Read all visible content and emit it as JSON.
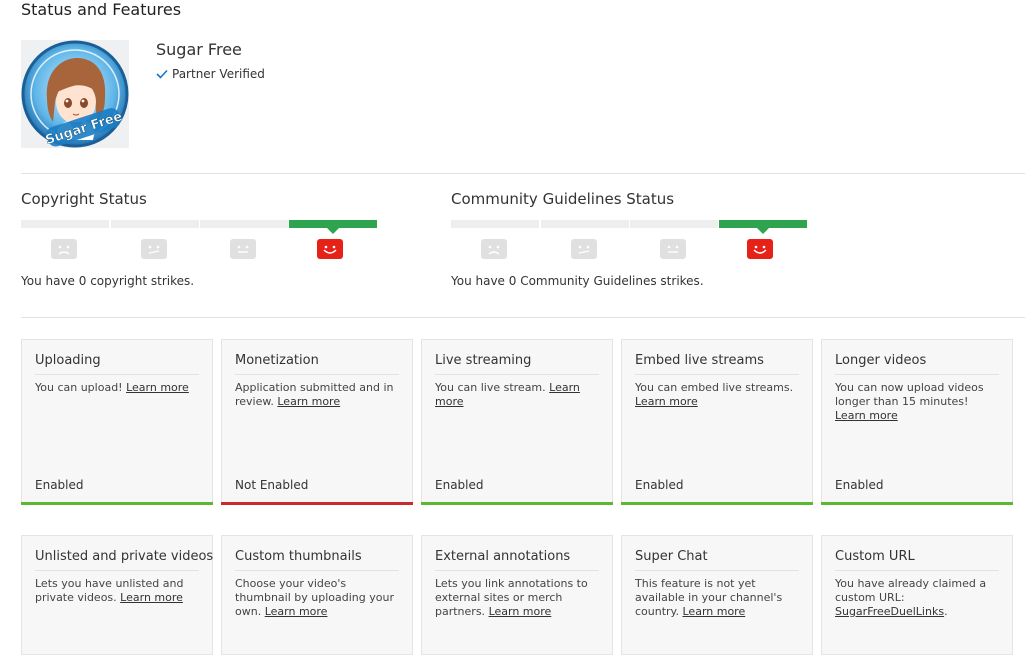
{
  "page": {
    "title": "Status and Features"
  },
  "channel": {
    "name": "Sugar Free",
    "verified_label": "Partner Verified",
    "avatar_text": "Sugar Free"
  },
  "colors": {
    "enabled": "#5cb731",
    "not_enabled": "#cc2a2a",
    "active_meter": "#2ea44f",
    "active_face": "#e62117"
  },
  "copyright": {
    "title": "Copyright Status",
    "message": "You have 0 copyright strikes."
  },
  "community": {
    "title": "Community Guidelines Status",
    "message": "You have 0 Community Guidelines strikes."
  },
  "features_row1": [
    {
      "title": "Uploading",
      "text": "You can upload!",
      "link": "Learn more",
      "status": "Enabled"
    },
    {
      "title": "Monetization",
      "text": "Application submitted and in review.",
      "link": "Learn more",
      "status": "Not Enabled"
    },
    {
      "title": "Live streaming",
      "text": "You can live stream.",
      "link": "Learn more",
      "status": "Enabled"
    },
    {
      "title": "Embed live streams",
      "text": "You can embed live streams.",
      "link": "Learn more",
      "status": "Enabled"
    },
    {
      "title": "Longer videos",
      "text": "You can now upload videos longer than 15 minutes!",
      "link": "Learn more",
      "status": "Enabled"
    }
  ],
  "features_row2": [
    {
      "title": "Unlisted and private videos",
      "text": "Lets you have unlisted and private videos.",
      "link": "Learn more"
    },
    {
      "title": "Custom thumbnails",
      "text": "Choose your video's thumbnail by uploading your own.",
      "link": "Learn more"
    },
    {
      "title": "External annotations",
      "text": "Lets you link annotations to external sites or merch partners.",
      "link": "Learn more"
    },
    {
      "title": "Super Chat",
      "text": "This feature is not yet available in your channel's country.",
      "link": "Learn more"
    },
    {
      "title": "Custom URL",
      "text": "You have already claimed a custom URL:",
      "link": "SugarFreeDuelLinks",
      "suffix": "."
    }
  ]
}
